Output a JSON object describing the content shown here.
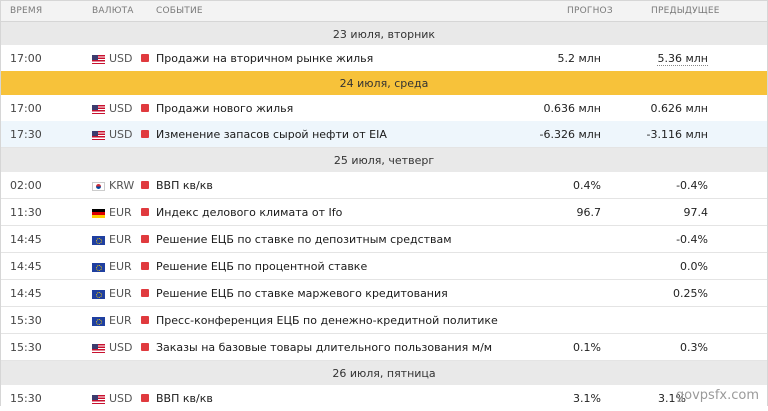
{
  "columns": {
    "time": "ВРЕМЯ",
    "currency": "ВАЛЮТА",
    "event": "СОБЫТИЕ",
    "forecast": "ПРОГНОЗ",
    "previous": "ПРЕДЫДУЩЕЕ"
  },
  "dates": {
    "d23": "23 июля, вторник",
    "d24": "24 июля, среда",
    "d25": "25 июля, четверг",
    "d26": "26 июля, пятница"
  },
  "rows": [
    {
      "time": "17:00",
      "flag": "us-flag-icon",
      "currency": "USD",
      "event": "Продажи на вторичном рынке жилья",
      "forecast": "5.2 млн",
      "previous": "5.36 млн"
    },
    {
      "time": "17:00",
      "flag": "us-flag-icon",
      "currency": "USD",
      "event": "Продажи нового жилья",
      "forecast": "0.636 млн",
      "previous": "0.626 млн"
    },
    {
      "time": "17:30",
      "flag": "us-flag-icon",
      "currency": "USD",
      "event": "Изменение запасов сырой нефти от EIA",
      "forecast": "-6.326 млн",
      "previous": "-3.116 млн"
    },
    {
      "time": "02:00",
      "flag": "kr-flag-icon",
      "currency": "KRW",
      "event": "ВВП кв/кв",
      "forecast": "0.4%",
      "previous": "-0.4%"
    },
    {
      "time": "11:30",
      "flag": "de-flag-icon",
      "currency": "EUR",
      "event": "Индекс делового климата от Ifo",
      "forecast": "96.7",
      "previous": "97.4"
    },
    {
      "time": "14:45",
      "flag": "eu-flag-icon",
      "currency": "EUR",
      "event": "Решение ЕЦБ по ставке по депозитным средствам",
      "forecast": "",
      "previous": "-0.4%"
    },
    {
      "time": "14:45",
      "flag": "eu-flag-icon",
      "currency": "EUR",
      "event": "Решение ЕЦБ по процентной ставке",
      "forecast": "",
      "previous": "0.0%"
    },
    {
      "time": "14:45",
      "flag": "eu-flag-icon",
      "currency": "EUR",
      "event": "Решение ЕЦБ по ставке маржевого кредитования",
      "forecast": "",
      "previous": "0.25%"
    },
    {
      "time": "15:30",
      "flag": "eu-flag-icon",
      "currency": "EUR",
      "event": "Пресс-конференция ЕЦБ по денежно-кредитной политике",
      "forecast": "",
      "previous": ""
    },
    {
      "time": "15:30",
      "flag": "us-flag-icon",
      "currency": "USD",
      "event": "Заказы на базовые товары длительного пользования м/м",
      "forecast": "0.1%",
      "previous": "0.3%"
    },
    {
      "time": "15:30",
      "flag": "us-flag-icon",
      "currency": "USD",
      "event": "ВВП кв/кв",
      "forecast": "3.1%",
      "previous": "3.1%"
    }
  ],
  "importance_color": "#e03a3e",
  "today_color": "#f7c23a",
  "watermark": "govpsfx.com"
}
